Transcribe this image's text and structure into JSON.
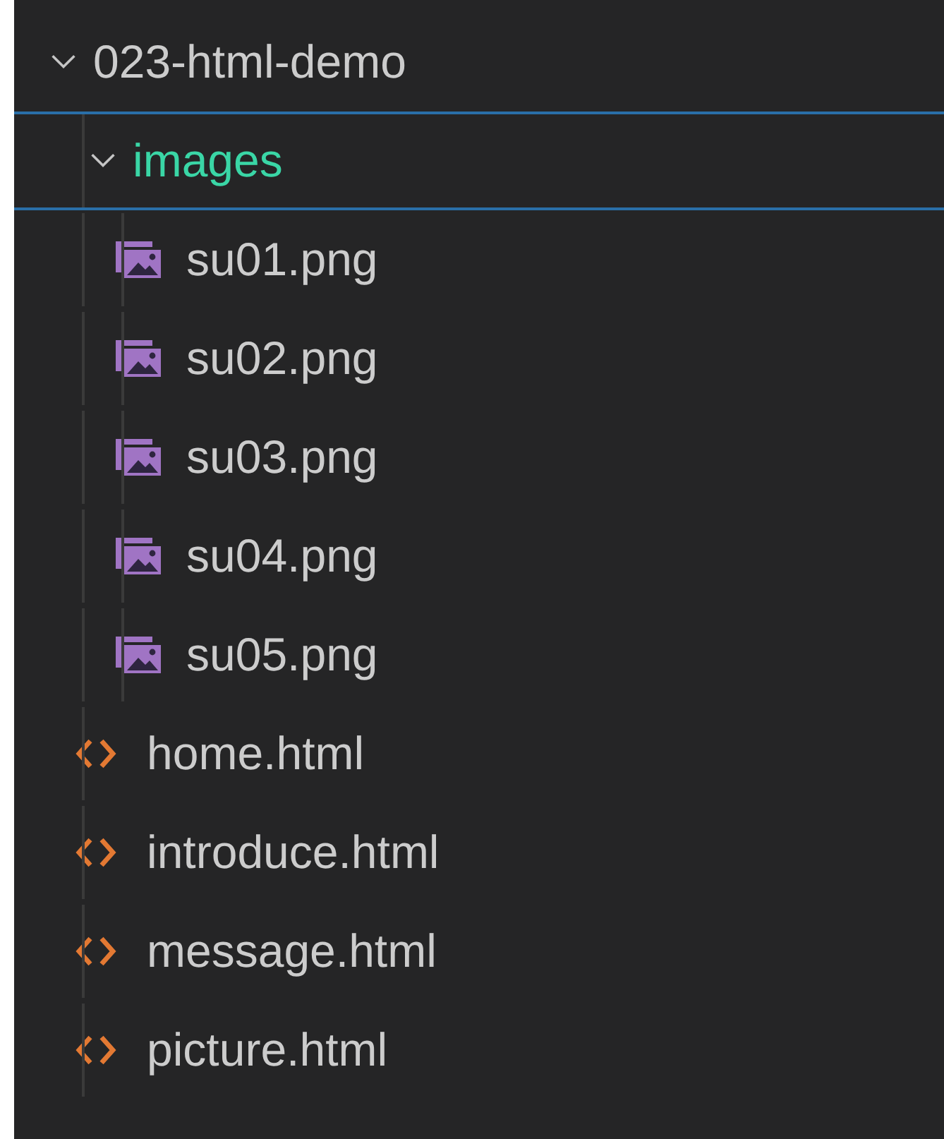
{
  "explorer": {
    "tree": [
      {
        "label": "023-html-demo",
        "kind": "folder",
        "expanded": true,
        "focused": false,
        "untracked": false,
        "children": [
          {
            "label": "images",
            "kind": "folder",
            "expanded": true,
            "focused": true,
            "untracked": true,
            "children": [
              {
                "label": "su01.png",
                "kind": "image",
                "focused": false,
                "untracked": false
              },
              {
                "label": "su02.png",
                "kind": "image",
                "focused": false,
                "untracked": false
              },
              {
                "label": "su03.png",
                "kind": "image",
                "focused": false,
                "untracked": false
              },
              {
                "label": "su04.png",
                "kind": "image",
                "focused": false,
                "untracked": false
              },
              {
                "label": "su05.png",
                "kind": "image",
                "focused": false,
                "untracked": false
              }
            ]
          },
          {
            "label": "home.html",
            "kind": "html",
            "focused": false,
            "untracked": false
          },
          {
            "label": "introduce.html",
            "kind": "html",
            "focused": false,
            "untracked": false
          },
          {
            "label": "message.html",
            "kind": "html",
            "focused": false,
            "untracked": false
          },
          {
            "label": "picture.html",
            "kind": "html",
            "focused": false,
            "untracked": false
          }
        ]
      }
    ]
  }
}
